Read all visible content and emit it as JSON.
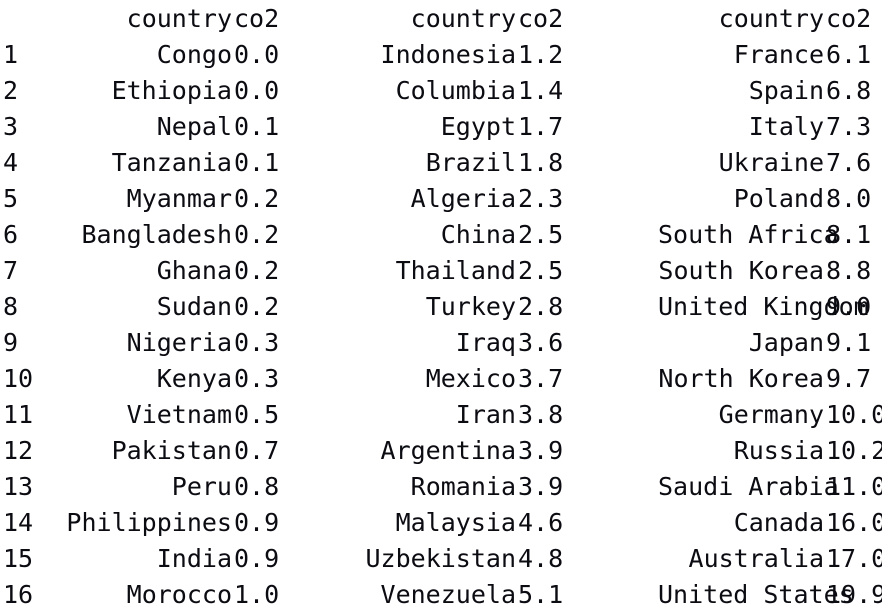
{
  "table": {
    "headers": {
      "index": "",
      "country": "country",
      "co2": "co2"
    },
    "blocks": [
      {
        "name": "block-1",
        "rows": [
          {
            "index": "1",
            "country": "Congo",
            "co2": "0.0"
          },
          {
            "index": "2",
            "country": "Ethiopia",
            "co2": "0.0"
          },
          {
            "index": "3",
            "country": "Nepal",
            "co2": "0.1"
          },
          {
            "index": "4",
            "country": "Tanzania",
            "co2": "0.1"
          },
          {
            "index": "5",
            "country": "Myanmar",
            "co2": "0.2"
          },
          {
            "index": "6",
            "country": "Bangladesh",
            "co2": "0.2"
          },
          {
            "index": "7",
            "country": "Ghana",
            "co2": "0.2"
          },
          {
            "index": "8",
            "country": "Sudan",
            "co2": "0.2"
          },
          {
            "index": "9",
            "country": "Nigeria",
            "co2": "0.3"
          },
          {
            "index": "10",
            "country": "Kenya",
            "co2": "0.3"
          },
          {
            "index": "11",
            "country": "Vietnam",
            "co2": "0.5"
          },
          {
            "index": "12",
            "country": "Pakistan",
            "co2": "0.7"
          },
          {
            "index": "13",
            "country": "Peru",
            "co2": "0.8"
          },
          {
            "index": "14",
            "country": "Philippines",
            "co2": "0.9"
          },
          {
            "index": "15",
            "country": "India",
            "co2": "0.9"
          },
          {
            "index": "16",
            "country": "Morocco",
            "co2": "1.0"
          }
        ]
      },
      {
        "name": "block-2",
        "rows": [
          {
            "country": "Indonesia",
            "co2": "1.2"
          },
          {
            "country": "Columbia",
            "co2": "1.4"
          },
          {
            "country": "Egypt",
            "co2": "1.7"
          },
          {
            "country": "Brazil",
            "co2": "1.8"
          },
          {
            "country": "Algeria",
            "co2": "2.3"
          },
          {
            "country": "China",
            "co2": "2.5"
          },
          {
            "country": "Thailand",
            "co2": "2.5"
          },
          {
            "country": "Turkey",
            "co2": "2.8"
          },
          {
            "country": "Iraq",
            "co2": "3.6"
          },
          {
            "country": "Mexico",
            "co2": "3.7"
          },
          {
            "country": "Iran",
            "co2": "3.8"
          },
          {
            "country": "Argentina",
            "co2": "3.9"
          },
          {
            "country": "Romania",
            "co2": "3.9"
          },
          {
            "country": "Malaysia",
            "co2": "4.6"
          },
          {
            "country": "Uzbekistan",
            "co2": "4.8"
          },
          {
            "country": "Venezuela",
            "co2": "5.1"
          }
        ]
      },
      {
        "name": "block-3",
        "rows": [
          {
            "country": "France",
            "co2": "6.1"
          },
          {
            "country": "Spain",
            "co2": "6.8"
          },
          {
            "country": "Italy",
            "co2": "7.3"
          },
          {
            "country": "Ukraine",
            "co2": "7.6"
          },
          {
            "country": "Poland",
            "co2": "8.0"
          },
          {
            "country": "South Africa",
            "co2": "8.1"
          },
          {
            "country": "South Korea",
            "co2": "8.8"
          },
          {
            "country": "United Kingdom",
            "co2": "9.0"
          },
          {
            "country": "Japan",
            "co2": "9.1"
          },
          {
            "country": "North Korea",
            "co2": "9.7"
          },
          {
            "country": "Germany",
            "co2": "10.0"
          },
          {
            "country": "Russia",
            "co2": "10.2"
          },
          {
            "country": "Saudi Arabia",
            "co2": "11.0"
          },
          {
            "country": "Canada",
            "co2": "16.0"
          },
          {
            "country": "Australia",
            "co2": "17.0"
          },
          {
            "country": "United States",
            "co2": "19.9"
          }
        ]
      }
    ]
  },
  "colors": {
    "background": "#ffffff",
    "text": "#0b0b12"
  }
}
